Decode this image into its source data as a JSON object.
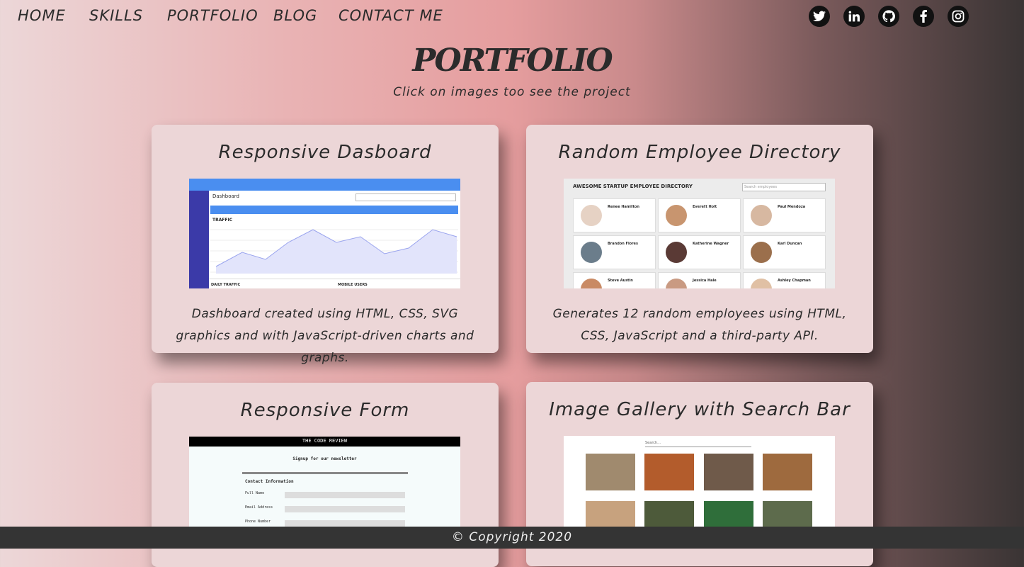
{
  "nav": {
    "items": [
      "HOME",
      "SKILLS",
      "PORTFOLIO",
      "BLOG",
      "CONTACT ME"
    ]
  },
  "social": {
    "icons": [
      "twitter-icon",
      "linkedin-icon",
      "github-icon",
      "facebook-icon",
      "instagram-icon"
    ]
  },
  "page": {
    "title": "PORTFOLIO",
    "subtitle": "Click on images too see the project"
  },
  "projects": [
    {
      "title": "Responsive Dasboard",
      "description": "Dashboard created using HTML, CSS, SVG graphics and with JavaScript-driven charts and graphs."
    },
    {
      "title": "Random Employee Directory",
      "description": "Generates 12 random employees using HTML, CSS, JavaScript and a third-party API."
    },
    {
      "title": "Responsive Form"
    },
    {
      "title": "Image Gallery with Search Bar"
    }
  ],
  "shots": {
    "dashboard": {
      "header": "Dashboard",
      "section": "TRAFFIC",
      "daily": "DAILY TRAFFIC",
      "mobile": "MOBILE USERS"
    },
    "directory": {
      "header": "AWESOME STARTUP EMPLOYEE DIRECTORY",
      "search": "Search employees",
      "names": [
        "Renee Hamilton",
        "Everett Holt",
        "Paul Mendoza",
        "Brandon Flores",
        "Katherine Wagner",
        "Karl Duncan",
        "Steve Austin",
        "Jessica Hale",
        "Ashley Chapman"
      ]
    },
    "form": {
      "header": "THE CODE REVIEW",
      "heading": "Signup for our newsletter",
      "section": "Contact Information",
      "labels": [
        "Full Name",
        "Email Address",
        "Phone Number"
      ]
    },
    "gallery": {
      "search": "Search..."
    }
  },
  "footer": {
    "text": "© Copyright 2020"
  }
}
